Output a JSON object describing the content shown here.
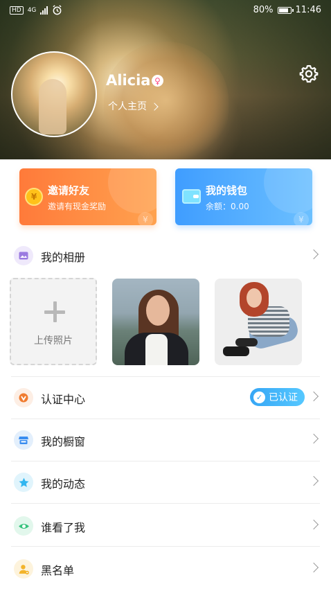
{
  "status_bar": {
    "network": "4G",
    "battery": "80%",
    "time": "11:46"
  },
  "profile": {
    "name": "Alicia",
    "homepage_label": "个人主页"
  },
  "cards": {
    "invite": {
      "title": "邀请好友",
      "subtitle": "邀请有现金奖励",
      "coin_glyph": "¥"
    },
    "wallet": {
      "title": "我的钱包",
      "subtitle": "余额：0.00",
      "coin_glyph": "¥"
    }
  },
  "album": {
    "title": "我的相册",
    "upload_label": "上传照片"
  },
  "menu": [
    {
      "label": "认证中心",
      "badge": "已认证",
      "icon": "certification-icon",
      "color": "#f07b2f"
    },
    {
      "label": "我的橱窗",
      "icon": "shop-window-icon",
      "color": "#3a8df0"
    },
    {
      "label": "我的动态",
      "icon": "star-icon",
      "color": "#31b6f0"
    },
    {
      "label": "谁看了我",
      "icon": "eye-icon",
      "color": "#35c27c"
    },
    {
      "label": "黑名单",
      "icon": "blacklist-user-icon",
      "color": "#f3b42a"
    }
  ],
  "colors": {
    "invite_card": "#ff8a3f",
    "wallet_card": "#4aa7ff",
    "verified_badge": "#3eb1f8"
  }
}
